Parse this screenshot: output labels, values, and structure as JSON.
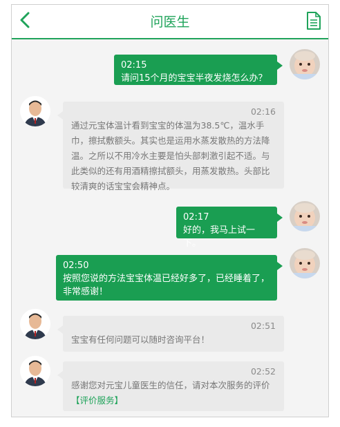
{
  "header": {
    "title": "问医生",
    "back_icon": "chevron-left-icon",
    "menu_icon": "document-icon",
    "accent_color": "#1fa35a"
  },
  "messages": [
    {
      "sender": "user",
      "time": "02:15",
      "text": "请问15个月的宝宝半夜发烧怎么办？"
    },
    {
      "sender": "doctor",
      "time": "02:16",
      "text": "通过元宝体温计看到宝宝的体温为38.5℃，温水手巾，擦拭敷额头。其实也是运用水蒸发散热的方法降温。之所以不用冷水主要是怕头部刺激引起不适。与此类似的还有用酒精擦拭额头，用蒸发散热。头部比较清爽的话宝宝会精神点。"
    },
    {
      "sender": "user",
      "time": "02:17",
      "text": "好的，我马上试一下。"
    },
    {
      "sender": "user",
      "time": "02:50",
      "text": "按照您说的方法宝宝体温已经好多了，已经睡着了，非常感谢！"
    },
    {
      "sender": "doctor",
      "time": "02:51",
      "text": "宝宝有任何问题可以随时咨询平台！"
    },
    {
      "sender": "doctor",
      "time": "02:52",
      "text": "感谢您对元宝儿童医生的信任，请对本次服务的评价",
      "link": "【评价服务】"
    }
  ]
}
